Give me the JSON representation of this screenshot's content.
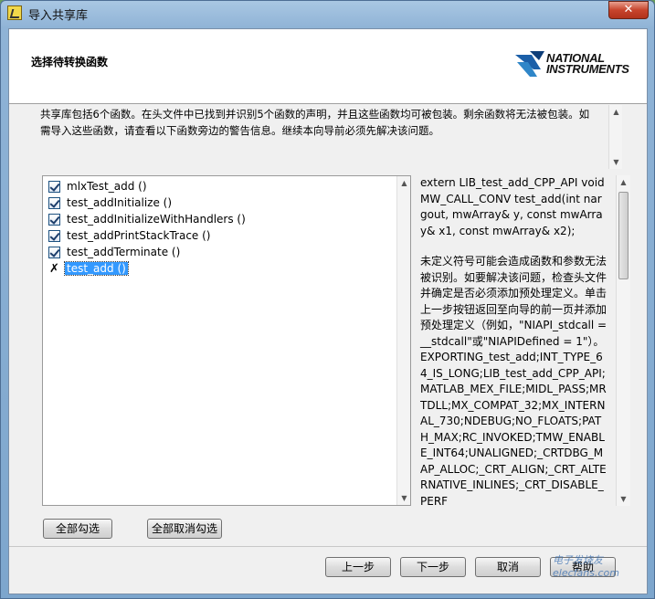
{
  "window": {
    "title": "导入共享库",
    "close_label": "✕"
  },
  "header": {
    "title": "选择待转换函数",
    "logo_line1": "NATIONAL",
    "logo_line2": "INSTRUMENTS"
  },
  "description": "共享库包括6个函数。在头文件中已找到并识别5个函数的声明，并且这些函数均可被包装。剩余函数将无法被包装。如需导入这些函数，请查看以下函数旁边的警告信息。继续本向导前必须先解决该问题。",
  "functions": [
    {
      "label": "mlxTest_add ()",
      "checked": true,
      "state": "checked"
    },
    {
      "label": "test_addInitialize ()",
      "checked": true,
      "state": "checked"
    },
    {
      "label": "test_addInitializeWithHandlers ()",
      "checked": true,
      "state": "checked"
    },
    {
      "label": "test_addPrintStackTrace ()",
      "checked": true,
      "state": "checked"
    },
    {
      "label": "test_addTerminate ()",
      "checked": true,
      "state": "checked"
    },
    {
      "label": "test_add ()",
      "checked": false,
      "state": "error",
      "selected": true
    }
  ],
  "error_mark": "✗",
  "detail": {
    "declaration": "extern LIB_test_add_CPP_API void MW_CALL_CONV test_add(int nargout, mwArray& y, const mwArray& x1, const mwArray& x2);",
    "message": "未定义符号可能会造成函数和参数无法被识别。如要解决该问题，检查头文件并确定是否必须添加预处理定义。单击上一步按钮返回至向导的前一页并添加预处理定义（例如，\"NIAPI_stdcall = __stdcall\"或\"NIAPIDefined = 1\"）。EXPORTING_test_add;INT_TYPE_64_IS_LONG;LIB_test_add_CPP_API;MATLAB_MEX_FILE;MIDL_PASS;MRTDLL;MX_COMPAT_32;MX_INTERNAL_730;NDEBUG;NO_FLOATS;PATH_MAX;RC_INVOKED;TMW_ENABLE_INT64;UNALIGNED;_CRTDBG_MAP_ALLOC;_CRT_ALIGN;_CRT_ALTERNATIVE_INLINES;_CRT_DISABLE_PERF"
  },
  "buttons": {
    "select_all": "全部勾选",
    "deselect_all": "全部取消勾选",
    "back": "上一步",
    "next": "下一步",
    "cancel": "取消",
    "help": "帮助"
  },
  "watermark": "电子发烧友 elecfans.com",
  "colors": {
    "selection": "#3399ff",
    "close_button": "#c7442c"
  }
}
